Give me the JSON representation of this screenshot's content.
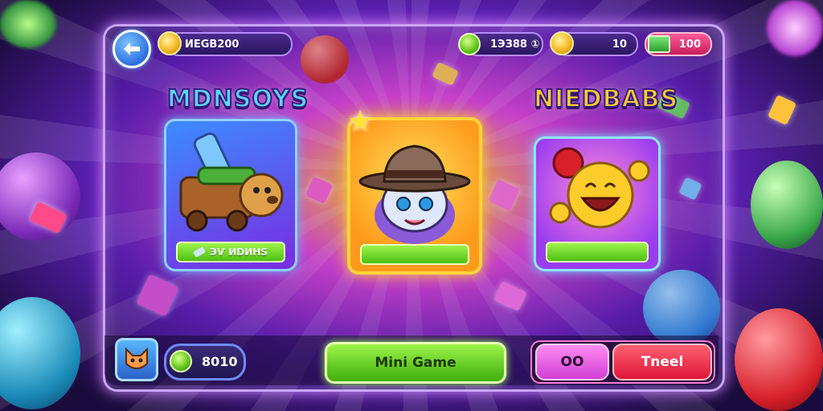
{
  "header": {
    "back_icon": "arrow-left-icon",
    "coins_value": "ИEGB200",
    "gems_value": "1ЭЗ88 ①",
    "level_value": "10",
    "cash_value": "100"
  },
  "sections": {
    "left_title": "MDNSOYS",
    "right_title": "NIEDBABS",
    "left_card_label": "ЭѴ ИDИHS",
    "mid_card_label": "",
    "right_card_label": ""
  },
  "footer": {
    "score_value": "8010",
    "mini_game_label": "Mini Game",
    "oo_label": "OO",
    "tneel_label": "Tneel"
  },
  "colors": {
    "accent_green": "#5cc31a",
    "accent_pink": "#d23fd6",
    "accent_red": "#e0163a",
    "panel_border": "#c9a6ff"
  }
}
